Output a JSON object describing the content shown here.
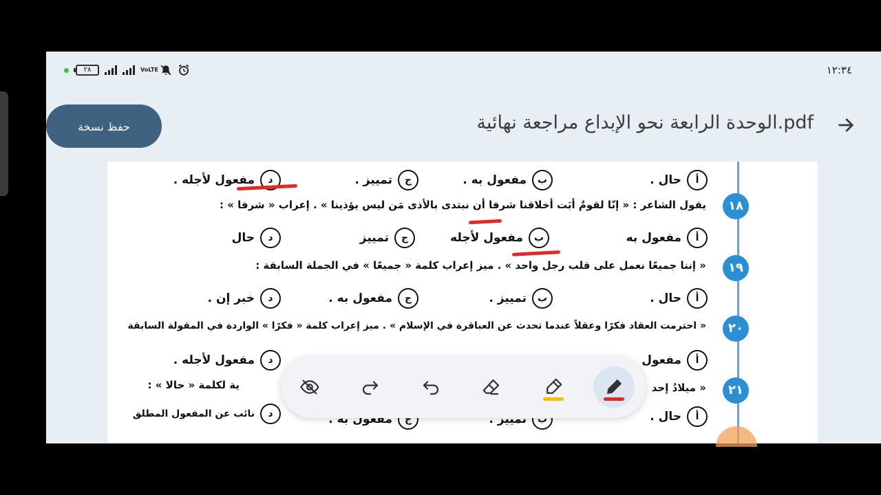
{
  "statusbar": {
    "time": "١٢:٣٤",
    "battery": "٢٨",
    "volte": "VoLTE"
  },
  "header": {
    "save_label": "حفظ نسخة",
    "title": "الوحدة الرابعة نحو الإبداع مراجعة نهائية.pdf"
  },
  "doc": {
    "q17_options": [
      "حال .",
      "مفعول به .",
      "تمييز .",
      "مفعول لأجله ."
    ],
    "q18_number": "١٨",
    "q18_text_a": "يقول الشاعر : « إنّا لقومٌ أبَت أخلاقنا شرفا   أن نبتدى بالأذى مَن ليس يؤذينا » . إعراب « شرفا » :",
    "q18_options": [
      "مفعول به",
      "مفعول لأجله",
      "تمييز",
      "حال"
    ],
    "q19_number": "١٩",
    "q19_text": "« إننا جميعًا نعمل على قلب رجل واحد » . ميز إعراب كلمة « جميعًا » في الجملة السابقة :",
    "q19_options": [
      "حال .",
      "تمييز .",
      "مفعول به .",
      "خبر إن ."
    ],
    "q20_number": "٢٠",
    "q20_text": "« احترمت العقاد فكرًا وعقلاً عندما تحدث عن العباقرة في الإسلام » . ميز إعراب كلمة « فكرًا » الواردة في المقولة السابقة",
    "q20_options": [
      "مفعول",
      "مفعول لأجله ."
    ],
    "q21_number": "٢١",
    "q21_text_right": "« ميلادُ إحد",
    "q21_text_left": "ية لكلمة « حالا » :",
    "q21_options": [
      "حال .",
      "تمييز .",
      "مفعول به .",
      "نائب عن المفعول المطلق"
    ],
    "letters": [
      "أ",
      "ب",
      "ج",
      "د"
    ]
  },
  "toolbar": {
    "tools": [
      "hide-annotations",
      "redo",
      "undo",
      "eraser",
      "highlighter",
      "pen"
    ],
    "highlighter_color": "#f2c200",
    "pen_color": "#e02a2a",
    "active_tool": "pen"
  }
}
